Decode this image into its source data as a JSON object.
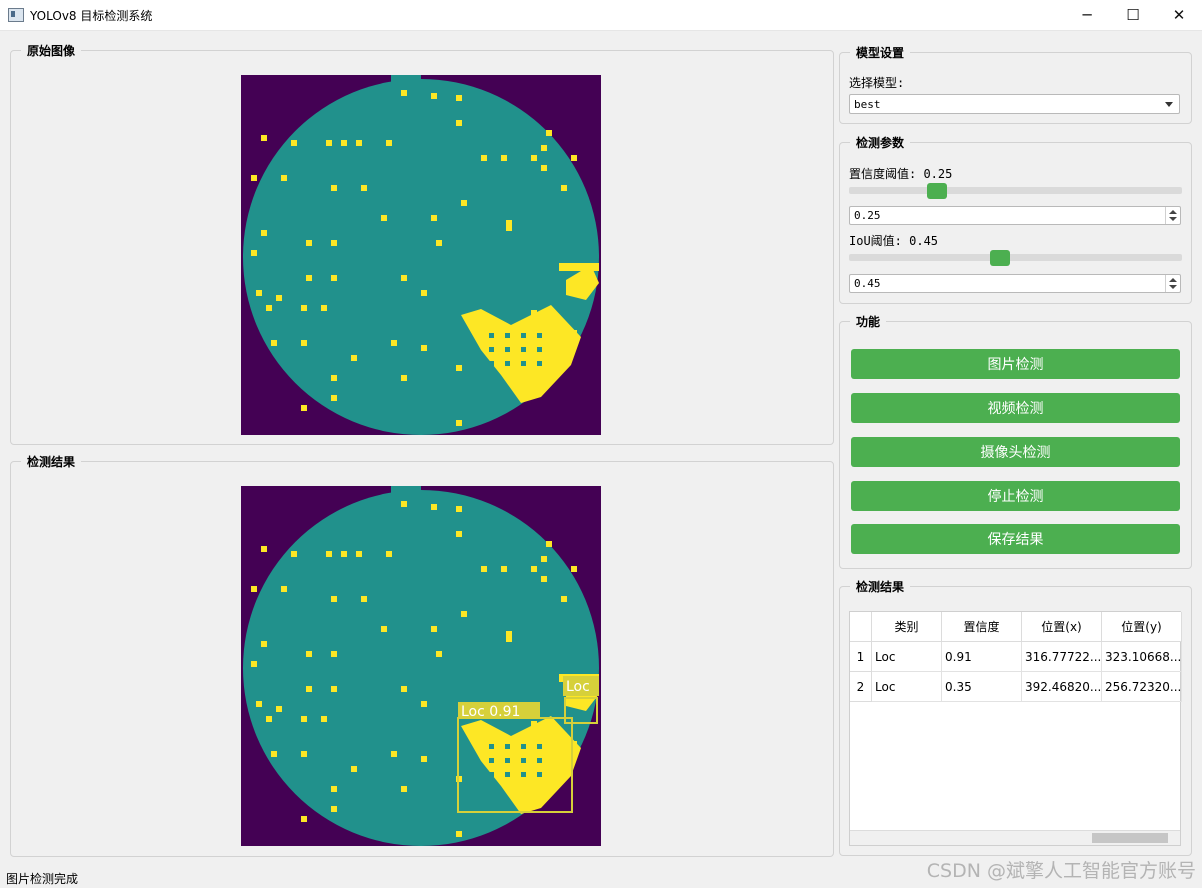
{
  "window": {
    "title": "YOLOv8 目标检测系统",
    "minimize_glyph": "─",
    "maximize_glyph": "☐",
    "close_glyph": "✕"
  },
  "groups": {
    "original": "原始图像",
    "result_image": "检测结果",
    "model_settings": "模型设置",
    "detect_params": "检测参数",
    "functions": "功能",
    "result_table": "检测结果"
  },
  "model": {
    "label": "选择模型:",
    "selected": "best"
  },
  "params": {
    "conf_label": "置信度阈值: 0.25",
    "conf_value": "0.25",
    "conf_level": 0.25,
    "iou_label": "IoU阈值: 0.45",
    "iou_value": "0.45",
    "iou_level": 0.45
  },
  "buttons": {
    "image_detect": "图片检测",
    "video_detect": "视频检测",
    "camera_detect": "摄像头检测",
    "stop_detect": "停止检测",
    "save_result": "保存结果"
  },
  "table": {
    "headers": [
      "类别",
      "置信度",
      "位置(x)",
      "位置(y)"
    ],
    "rows": [
      {
        "index": "1",
        "cells": [
          "Loc",
          "0.91",
          "316.77722...",
          "323.10668..."
        ]
      },
      {
        "index": "2",
        "cells": [
          "Loc",
          "0.35",
          "392.46820...",
          "256.72320..."
        ]
      }
    ]
  },
  "detections": [
    {
      "label": "Loc 0.91"
    },
    {
      "label": "Loc"
    }
  ],
  "colors": {
    "accent": "#4caf50",
    "bg_dark": "#440154",
    "teal": "#21918c",
    "yellow": "#fde725",
    "box": "#d6d03a"
  },
  "status_text": "图片检测完成",
  "watermark": "CSDN @斌擎人工智能官方账号"
}
